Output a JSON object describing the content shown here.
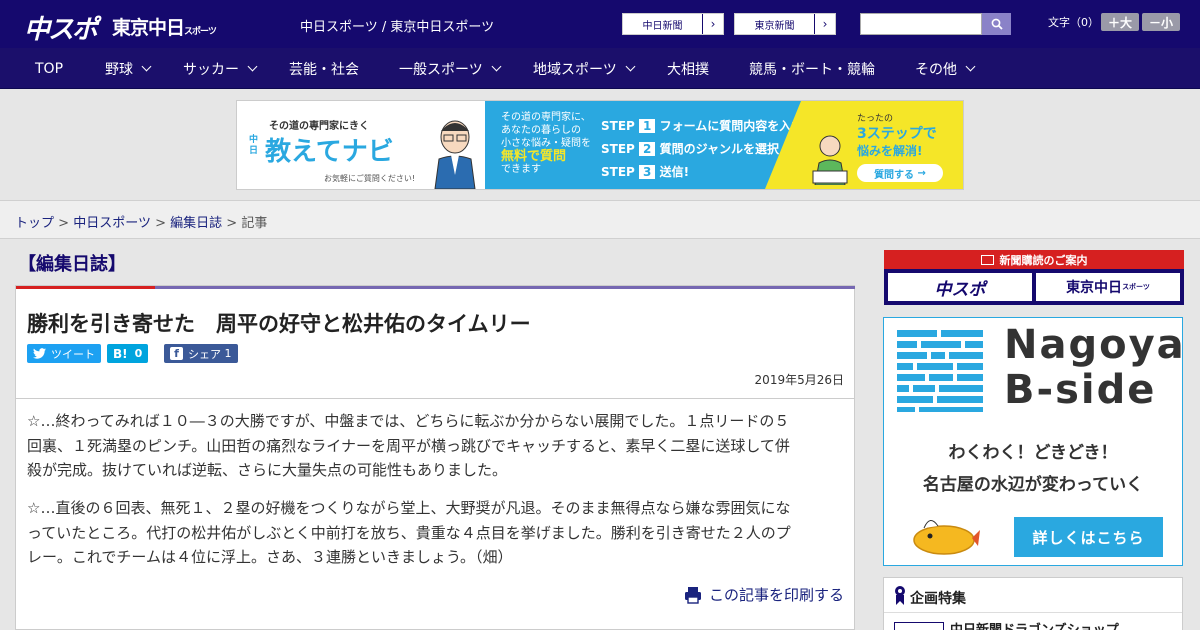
{
  "header": {
    "logo_chunichi_sports": "中スポ",
    "logo_tokyo_chunichi": "東京中日",
    "logo_tokyo_chunichi_small": "スポーツ",
    "site_title": "中日スポーツ / 東京中日スポーツ",
    "ext_links": [
      "中日新聞",
      "東京新聞"
    ],
    "search_placeholder": "",
    "font_size_label": "文字（0）",
    "font_plus": "＋大",
    "font_minus": "－小"
  },
  "nav": {
    "items": [
      {
        "label": "TOP"
      },
      {
        "label": "野球"
      },
      {
        "label": "サッカー"
      },
      {
        "label": "芸能・社会"
      },
      {
        "label": "一般スポーツ"
      },
      {
        "label": "地域スポーツ"
      },
      {
        "label": "大相撲"
      },
      {
        "label": "競馬・ボート・競輪"
      },
      {
        "label": "その他"
      }
    ]
  },
  "banner": {
    "tagline": "その道の専門家にきく",
    "brand_small": "中日",
    "brand": "教えてナビ",
    "note": "お気軽にご質問ください!",
    "mid_lines": [
      "その道の専門家に、",
      "あなたの暮らしの",
      "小さな悩み・疑問を"
    ],
    "mid_highlight": "無料で質問",
    "mid_end": "できます",
    "step_label": "STEP",
    "steps": [
      {
        "num": "1",
        "text": "フォームに質問内容を入力"
      },
      {
        "num": "2",
        "text": "質問のジャンルを選択"
      },
      {
        "num": "3",
        "text": "送信!"
      }
    ],
    "right_small": "たったの",
    "right_big": "3ステップで",
    "right_line": "悩みを解消!",
    "right_button": "質問する"
  },
  "breadcrumb": {
    "items": [
      "トップ",
      "中日スポーツ",
      "編集日誌",
      "記事"
    ],
    "separator": ">"
  },
  "section_title": "【編集日誌】",
  "article": {
    "headline": "勝利を引き寄せた　周平の好守と松井佑のタイムリー",
    "share": {
      "tweet": "ツイート",
      "hatena_count": "0",
      "hatena_logo": "B!",
      "facebook": "シェア",
      "facebook_count": "1"
    },
    "date": "2019年5月26日",
    "paragraphs": [
      [
        "☆…終わってみれば１０―３の大勝ですが、中盤までは、どちらに転ぶか分からない展開でした。１点リードの５",
        "回裏、１死満塁のピンチ。山田哲の痛烈なライナーを周平が横っ跳びでキャッチすると、素早く二塁に送球して併",
        "殺が完成。抜けていれば逆転、さらに大量失点の可能性もありました。"
      ],
      [
        "☆…直後の６回表、無死１、２塁の好機をつくりながら堂上、大野奨が凡退。そのまま無得点なら嫌な雰囲気にな",
        "っていたところ。代打の松井佑がしぶとく中前打を放ち、貴重な４点目を挙げました。勝利を引き寄せた２人のプ",
        "レー。これでチームは４位に浮上。さあ、３連勝といきましょう。（畑）"
      ]
    ],
    "print_label": "この記事を印刷する"
  },
  "sidebar": {
    "subscription_head": "新聞購読のご案内",
    "subscription_logos": [
      "中スポ",
      "東京中日"
    ],
    "subscription_logo_small": "スポーツ",
    "bside_title_1": "Nagoya",
    "bside_title_2": "B-side",
    "bside_text_1": "わくわく！どきどき！",
    "bside_text_2": "名古屋の水辺が変わっていく",
    "bside_button": "詳しくはこちら",
    "special_title": "企画特集",
    "special_item": "中日新聞ドラゴンズショップ"
  },
  "colors": {
    "header_bg": "#15096e",
    "accent_red": "#d62020",
    "accent_blue": "#2aa8e0",
    "accent_yellow": "#f5e628",
    "link": "#1a237e"
  }
}
